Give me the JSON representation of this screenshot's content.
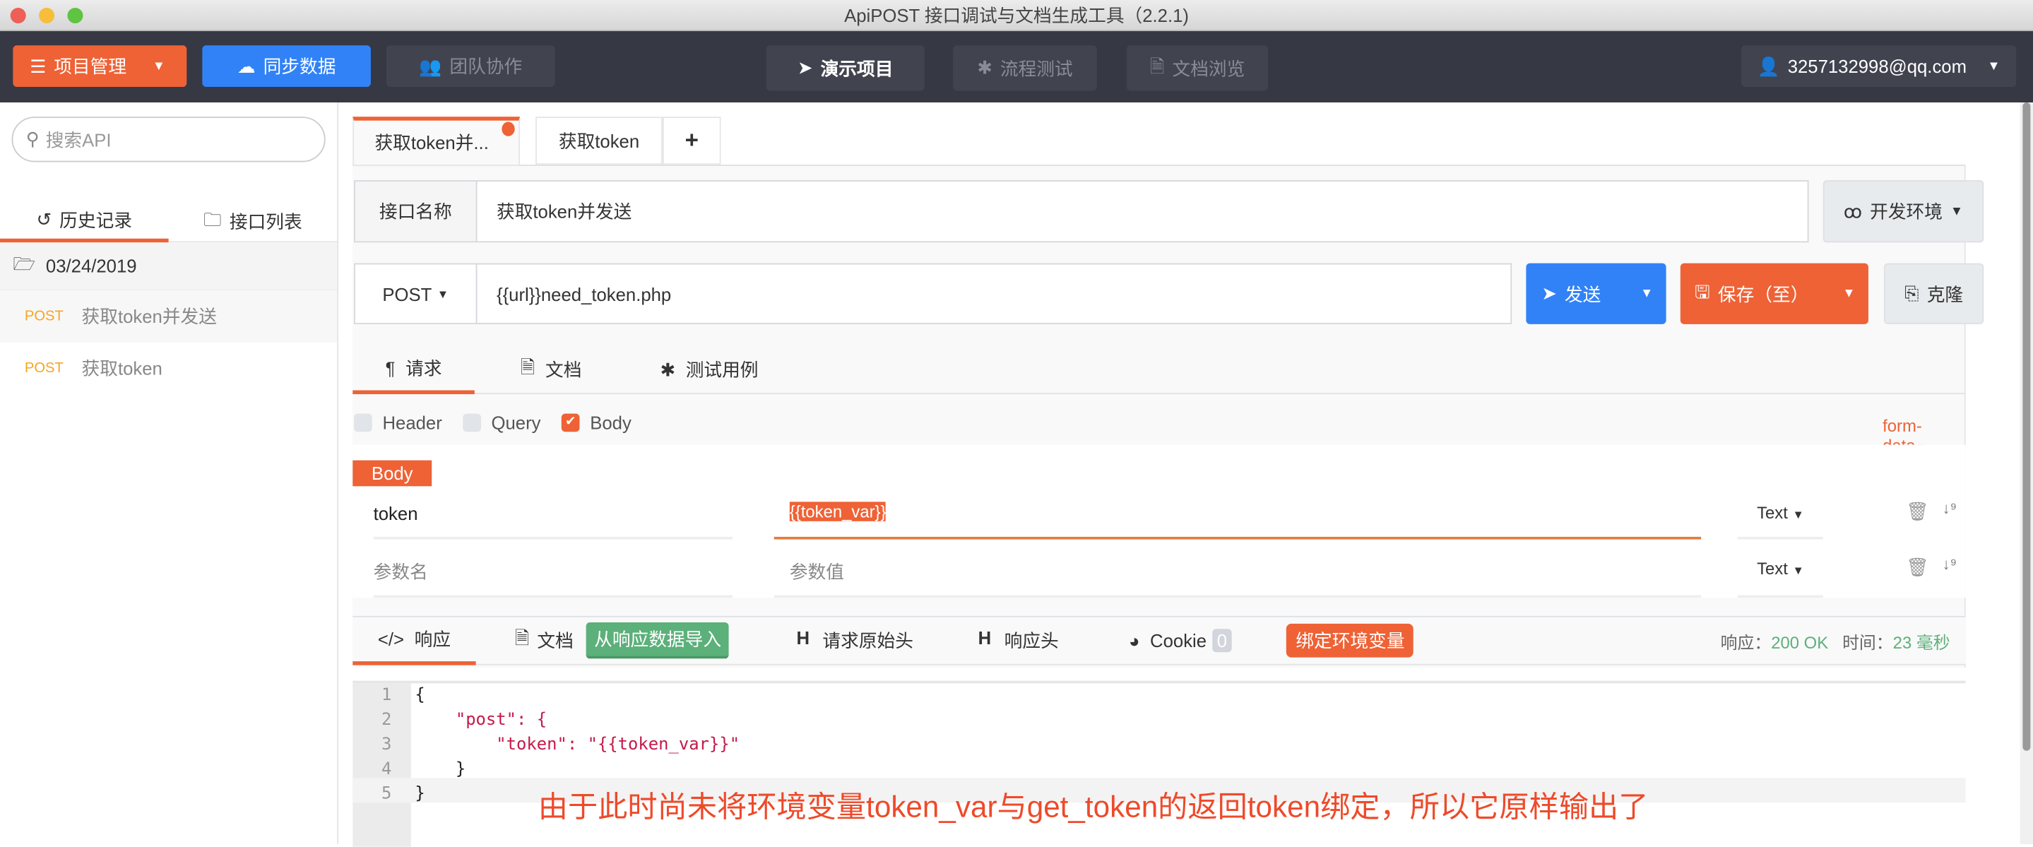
{
  "window": {
    "title": "ApiPOST 接口调试与文档生成工具（2.2.1)"
  },
  "toolbar": {
    "project_manage": "项目管理",
    "sync_data": "同步数据",
    "team": "团队协作",
    "demo_project": "演示项目",
    "flow_test": "流程测试",
    "doc_browse": "文档浏览",
    "user": "3257132998@qq.com"
  },
  "sidebar": {
    "search_placeholder": "搜索API",
    "tabs": [
      {
        "label": "历史记录",
        "active": true
      },
      {
        "label": "接口列表",
        "active": false
      }
    ],
    "folder": "03/24/2019",
    "items": [
      {
        "method": "POST",
        "name": "获取token并发送"
      },
      {
        "method": "POST",
        "name": "获取token"
      }
    ]
  },
  "tabs": [
    {
      "label": "获取token并...",
      "active": true,
      "modified": true
    },
    {
      "label": "获取token",
      "active": false
    }
  ],
  "tabs_add": "+",
  "request": {
    "name_label": "接口名称",
    "name_value": "获取token并发送",
    "env": "开发环境",
    "method": "POST",
    "url": "{{url}}need_token.php",
    "send": "发送",
    "save": "保存（至）",
    "clone": "克隆"
  },
  "req_tabs": [
    "请求",
    "文档",
    "测试用例"
  ],
  "params": {
    "checks": [
      {
        "label": "Header",
        "checked": false
      },
      {
        "label": "Query",
        "checked": false
      },
      {
        "label": "Body",
        "checked": true
      }
    ],
    "body_type": "form-data",
    "body_tag": "Body",
    "rows": [
      {
        "key": "token",
        "value": "{{token_var}}",
        "type": "Text"
      }
    ],
    "placeholder_key": "参数名",
    "placeholder_value": "参数值",
    "placeholder_type": "Text"
  },
  "response": {
    "tabs": [
      "响应",
      "文档",
      "请求原始头",
      "响应头",
      "Cookie"
    ],
    "import_btn": "从响应数据导入",
    "cookie_count": "0",
    "bind_env": "绑定环境变量",
    "status_label": "响应：",
    "status": "200 OK",
    "time_label": "时间：",
    "time": "23 毫秒",
    "code_lines": [
      "{",
      "    \"post\": {",
      "        \"token\": \"{{token_var}}\"",
      "    }",
      "}"
    ],
    "line_numbers": [
      "1",
      "2",
      "3",
      "4",
      "5"
    ]
  },
  "annotation": "由于此时尚未将环境变量token_var与get_token的返回token绑定，所以它原样输出了",
  "colors": {
    "orange": "#ee6236",
    "blue": "#3182f6",
    "green": "#5cb07a",
    "toolbar": "#363844"
  }
}
